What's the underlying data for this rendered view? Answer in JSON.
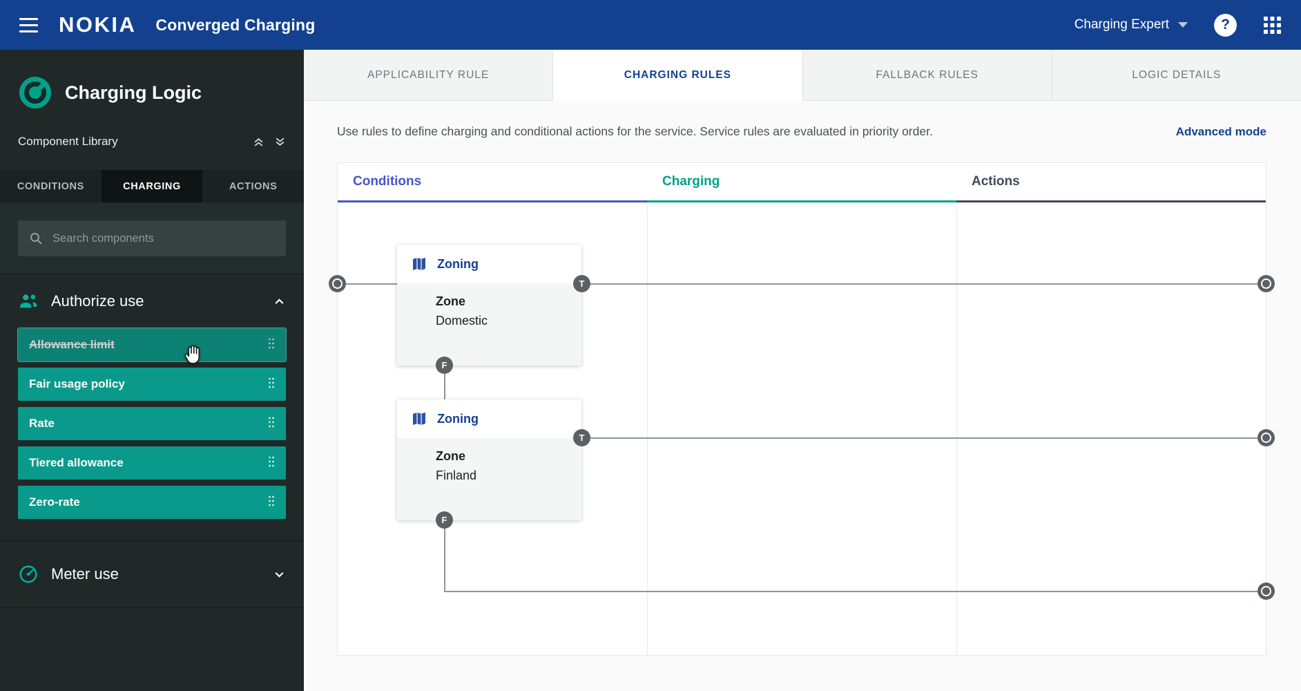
{
  "header": {
    "brand": "NOKIA",
    "product": "Converged Charging",
    "user_role": "Charging Expert"
  },
  "icons": {
    "menu": "hamburger",
    "help_glyph": "?",
    "apps": "grid-3x3",
    "search": "magnifier",
    "authorize_use": "people",
    "meter_use": "gauge",
    "zoning": "map",
    "drag_handle": "dots",
    "cursor": "grab-hand",
    "output_port": "target-circle"
  },
  "sidebar": {
    "title": "Charging Logic",
    "library_label": "Component Library",
    "tabs": [
      {
        "label": "CONDITIONS",
        "active": false
      },
      {
        "label": "CHARGING",
        "active": true
      },
      {
        "label": "ACTIONS",
        "active": false
      }
    ],
    "search_placeholder": "Search components",
    "groups": [
      {
        "label": "Authorize use",
        "expanded": true,
        "items": [
          {
            "label": "Allowance limit",
            "state": "dragging"
          },
          {
            "label": "Fair usage policy",
            "state": "normal"
          },
          {
            "label": "Rate",
            "state": "normal"
          },
          {
            "label": "Tiered allowance",
            "state": "normal"
          },
          {
            "label": "Zero-rate",
            "state": "normal"
          }
        ]
      },
      {
        "label": "Meter use",
        "expanded": false,
        "items": []
      }
    ]
  },
  "main": {
    "tabs": [
      {
        "label": "APPLICABILITY RULE",
        "active": false
      },
      {
        "label": "CHARGING RULES",
        "active": true
      },
      {
        "label": "FALLBACK RULES",
        "active": false
      },
      {
        "label": "LOGIC DETAILS",
        "active": false
      }
    ],
    "description": "Use rules to define charging and conditional actions for the service. Service rules are evaluated in priority order.",
    "advanced_mode_label": "Advanced mode",
    "canvas": {
      "columns": [
        {
          "label": "Conditions",
          "accent": "#4a54c8"
        },
        {
          "label": "Charging",
          "accent": "#00a189"
        },
        {
          "label": "Actions",
          "accent": "#3e4a5a"
        }
      ],
      "cards": [
        {
          "title": "Zoning",
          "field_label": "Zone",
          "field_value": "Domestic"
        },
        {
          "title": "Zoning",
          "field_label": "Zone",
          "field_value": "Finland"
        }
      ],
      "ports": {
        "true_label": "T",
        "false_label": "F"
      }
    }
  },
  "colors": {
    "brand_blue": "#13418f",
    "teal": "#0a9a8b",
    "accent_conditions": "#4a54c8",
    "accent_charging": "#00a189",
    "accent_actions": "#3e4a5a",
    "sidebar_bg": "#202928"
  }
}
